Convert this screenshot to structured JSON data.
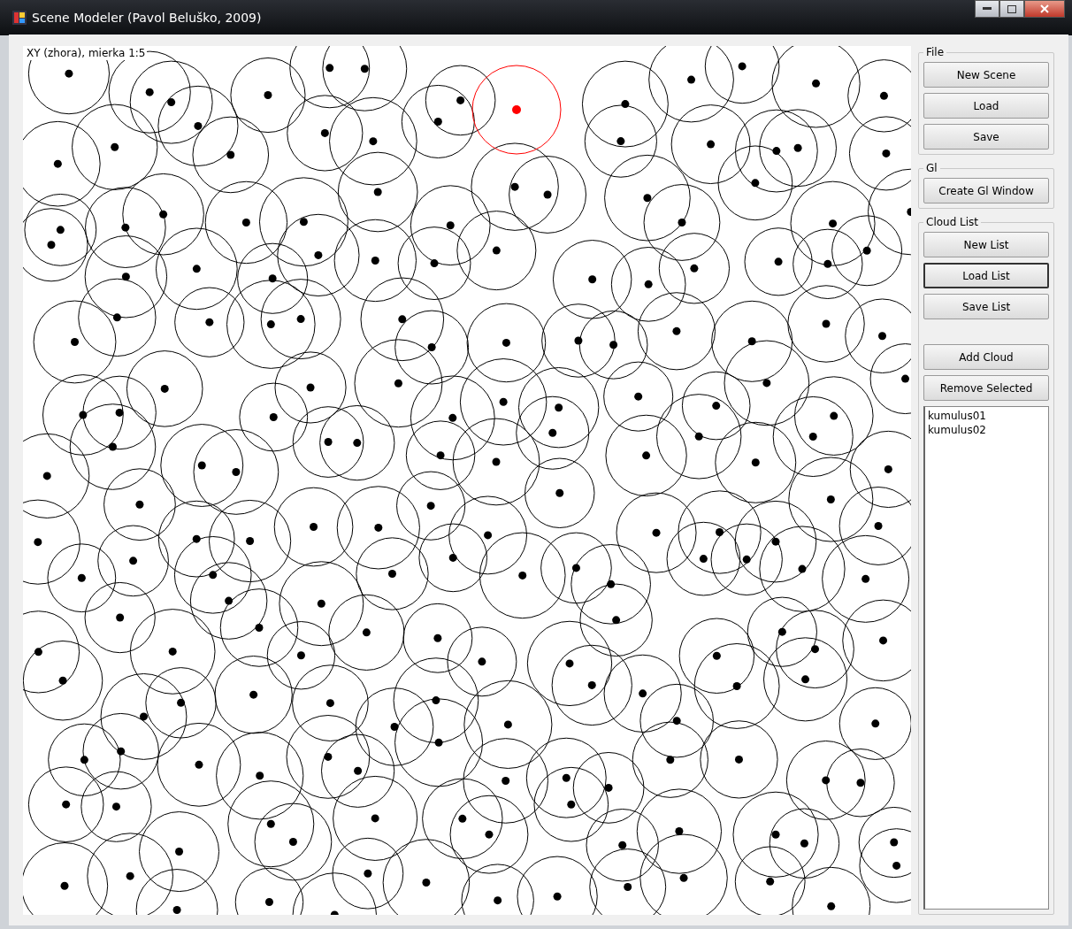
{
  "window": {
    "title": "Scene Modeler (Pavol Beluško, 2009)"
  },
  "view": {
    "label": "XY (zhora), mierka 1:5"
  },
  "groups": [
    {
      "title": "File",
      "buttons": [
        {
          "label": "New Scene",
          "focused": false
        },
        {
          "label": "Load",
          "focused": false
        },
        {
          "label": "Save",
          "focused": false
        }
      ]
    },
    {
      "title": "Gl",
      "buttons": [
        {
          "label": "Create Gl Window",
          "focused": false
        }
      ]
    },
    {
      "title": "Cloud List",
      "buttons": [
        {
          "label": "New List",
          "focused": false
        },
        {
          "label": "Load List",
          "focused": true
        },
        {
          "label": "Save List",
          "focused": false
        },
        {
          "label": "Add Cloud",
          "focused": false
        },
        {
          "label": "Remove Selected",
          "focused": false
        }
      ],
      "list": [
        {
          "label": "kumulus01",
          "selected": false
        },
        {
          "label": "kumulus02",
          "selected": false
        }
      ]
    }
  ]
}
